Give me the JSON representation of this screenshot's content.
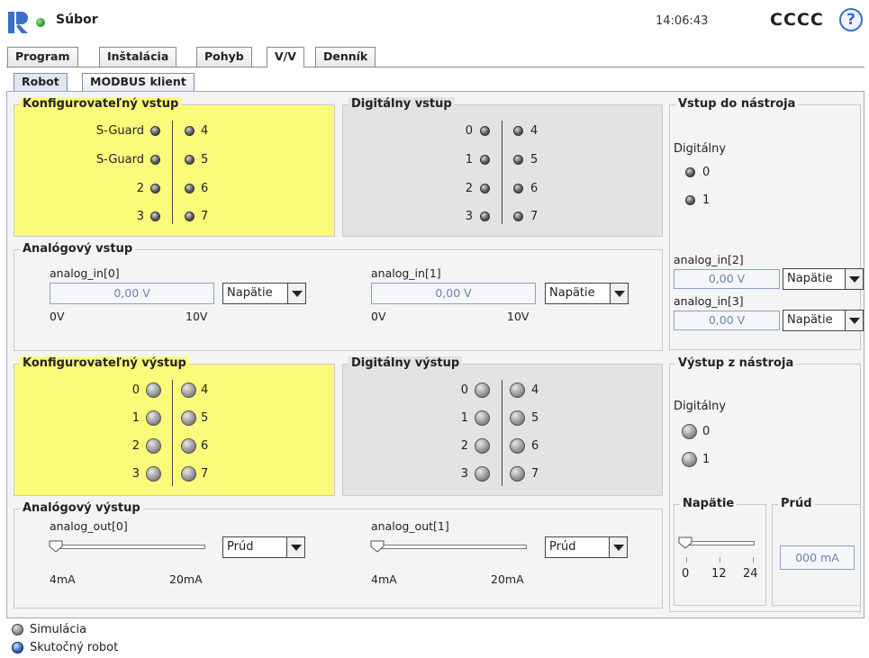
{
  "header": {
    "file_label": "Súbor",
    "time": "14:06:43",
    "robot_name": "CCCC",
    "help": "?"
  },
  "tabs": [
    "Program",
    "Inštalácia",
    "Pohyb",
    "V/V",
    "Denník"
  ],
  "subtabs": [
    "Robot",
    "MODBUS klient"
  ],
  "config_input": {
    "title": "Konfigurovateľný vstup",
    "left": [
      "S-Guard",
      "S-Guard",
      "2",
      "3"
    ],
    "right": [
      "4",
      "5",
      "6",
      "7"
    ]
  },
  "digital_input": {
    "title": "Digitálny vstup",
    "left": [
      "0",
      "1",
      "2",
      "3"
    ],
    "right": [
      "4",
      "5",
      "6",
      "7"
    ]
  },
  "tool_input": {
    "title": "Vstup do nástroja",
    "digital_label": "Digitálny",
    "items": [
      "0",
      "1"
    ],
    "analog2_label": "analog_in[2]",
    "analog2_value": "0,00 V",
    "analog2_mode": "Napätie",
    "analog3_label": "analog_in[3]",
    "analog3_value": "0,00 V",
    "analog3_mode": "Napätie"
  },
  "analog_input": {
    "title": "Analógový vstup",
    "ch0_label": "analog_in[0]",
    "ch0_value": "0,00 V",
    "ch0_mode": "Napätie",
    "ch0_min": "0V",
    "ch0_max": "10V",
    "ch1_label": "analog_in[1]",
    "ch1_value": "0,00 V",
    "ch1_mode": "Napätie",
    "ch1_min": "0V",
    "ch1_max": "10V"
  },
  "config_output": {
    "title": "Konfigurovateľný výstup",
    "left": [
      "0",
      "1",
      "2",
      "3"
    ],
    "right": [
      "4",
      "5",
      "6",
      "7"
    ]
  },
  "digital_output": {
    "title": "Digitálny výstup",
    "left": [
      "0",
      "1",
      "2",
      "3"
    ],
    "right": [
      "4",
      "5",
      "6",
      "7"
    ]
  },
  "tool_output": {
    "title": "Výstup z nástroja",
    "digital_label": "Digitálny",
    "items": [
      "0",
      "1"
    ],
    "voltage_title": "Napätie",
    "voltage_ticks": [
      "0",
      "12",
      "24"
    ],
    "current_title": "Prúd",
    "current_value": "000 mA"
  },
  "analog_output": {
    "title": "Analógový výstup",
    "ch0_label": "analog_out[0]",
    "ch0_mode": "Prúd",
    "ch0_min": "4mA",
    "ch0_max": "20mA",
    "ch1_label": "analog_out[1]",
    "ch1_mode": "Prúd",
    "ch1_min": "4mA",
    "ch1_max": "20mA"
  },
  "footer": {
    "simulation": "Simulácia",
    "real_robot": "Skutočný robot"
  },
  "colors": {
    "configurable_bg": "#fbfb7a",
    "digital_bg": "#e3e3e3",
    "status_green": "#2e9e2e",
    "accent_blue": "#3b6fc9"
  },
  "icons": [
    "ur-logo-icon",
    "status-led-icon",
    "help-icon",
    "io-led-icon",
    "dropdown-arrow-icon",
    "slider-knob-icon"
  ]
}
